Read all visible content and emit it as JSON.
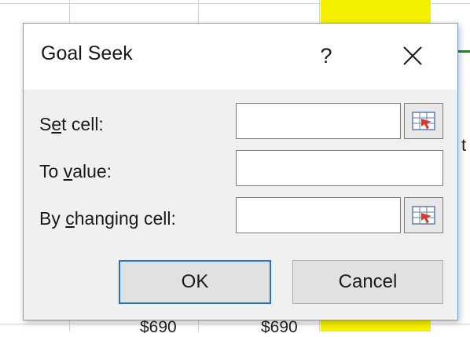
{
  "background": {
    "cell_texts": [
      "$690",
      "$690"
    ],
    "edge_text": "t"
  },
  "dialog": {
    "title": "Goal Seek",
    "help_label": "?",
    "close_icon": "close-icon",
    "fields": [
      {
        "label_pre": "S",
        "label_ul": "e",
        "label_post": "t cell:",
        "value": "",
        "has_picker": true
      },
      {
        "label_pre": "To ",
        "label_ul": "v",
        "label_post": "alue:",
        "value": "",
        "has_picker": false
      },
      {
        "label_pre": "By ",
        "label_ul": "c",
        "label_post": "hanging cell:",
        "value": "",
        "has_picker": true
      }
    ],
    "picker_icon": "range-picker-icon",
    "ok_label": "OK",
    "cancel_label": "Cancel"
  },
  "colors": {
    "accent": "#1e73c8",
    "highlight_column": "#f4f000",
    "dialog_border": "#6e9ecf"
  }
}
